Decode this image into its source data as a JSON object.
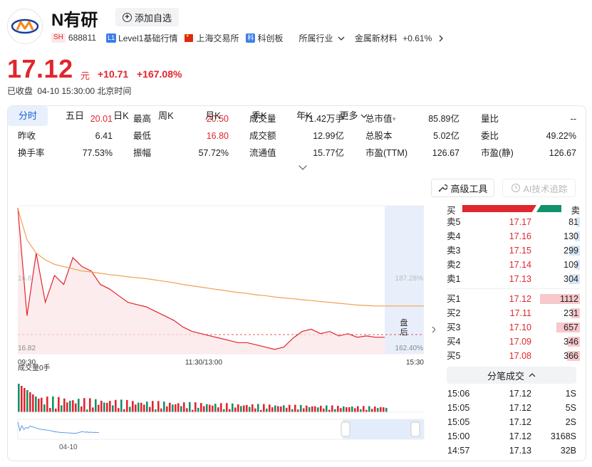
{
  "stock": {
    "name": "N有研",
    "market_tag": "SH",
    "code": "688811",
    "level_tag": "L1",
    "level_text": "Level1基础行情",
    "exchange": "上海交易所",
    "board_tag": "科",
    "board": "科创板",
    "industry_label": "所属行业",
    "sector": "金属新材料",
    "sector_change": "+0.61%",
    "watch_label": "添加自选"
  },
  "quote": {
    "price": "17.12",
    "unit": "元",
    "change": "+10.71",
    "change_pct": "+167.08%",
    "status": "已收盘",
    "datetime": "04-10 15:30:00 北京时间"
  },
  "stats": [
    [
      {
        "label": "今开",
        "value": "20.01",
        "color": "red"
      },
      {
        "label": "最高",
        "value": "20.50",
        "color": "red"
      },
      {
        "label": "成交量",
        "value": "71.42万手"
      },
      {
        "label": "总市值",
        "value": "85.89亿",
        "dropdown": true
      },
      {
        "label": "量比",
        "value": "--"
      }
    ],
    [
      {
        "label": "昨收",
        "value": "6.41"
      },
      {
        "label": "最低",
        "value": "16.80",
        "color": "red"
      },
      {
        "label": "成交额",
        "value": "12.99亿"
      },
      {
        "label": "总股本",
        "value": "5.02亿"
      },
      {
        "label": "委比",
        "value": "49.22%"
      }
    ],
    [
      {
        "label": "换手率",
        "value": "77.53%"
      },
      {
        "label": "振幅",
        "value": "57.72%"
      },
      {
        "label": "流通值",
        "value": "15.77亿"
      },
      {
        "label": "市盈(TTM)",
        "value": "126.67"
      },
      {
        "label": "市盈(静)",
        "value": "126.67"
      }
    ]
  ],
  "tabs": [
    "分时",
    "五日",
    "日K",
    "周K",
    "月K",
    "季K",
    "年K",
    "更多"
  ],
  "active_tab": 0,
  "tools": {
    "advanced": "高级工具",
    "ai": "AI技术追踪"
  },
  "chart": {
    "high_label": "16.8",
    "low_label": "16.82",
    "pct_high": "187.28%",
    "pct_low": "162.40%",
    "time_start": "09:30",
    "time_mid": "11:30/13:00",
    "time_end": "15:30",
    "after_hours": "盘后",
    "volume_label": "成交量0手",
    "nav_date": "04-10"
  },
  "chart_data": {
    "type": "line",
    "title": "",
    "xlabel": "",
    "ylabel": "",
    "x_ticks": [
      "09:30",
      "11:30/13:00",
      "15:30"
    ],
    "series": [
      {
        "values": [
          20.01,
          17.6,
          19.0,
          17.9,
          18.5,
          18.3,
          18.9,
          18.7,
          18.6,
          18.3,
          18.2,
          18.05,
          17.9,
          17.85,
          17.8,
          17.7,
          17.6,
          17.5,
          17.35,
          17.25,
          17.2,
          17.15,
          17.1,
          17.05,
          17.0,
          17.0,
          16.95,
          16.9,
          16.85,
          16.9,
          17.1,
          17.25,
          17.3,
          17.2,
          17.25,
          17.15,
          17.2,
          17.12,
          17.15,
          17.12,
          17.12
        ]
      },
      {
        "values": [
          20.0,
          19.3,
          19.0,
          18.85,
          18.75,
          18.7,
          18.65,
          18.6,
          18.58,
          18.55,
          18.52,
          18.5,
          18.47,
          18.45,
          18.43,
          18.4,
          18.37,
          18.34,
          18.3,
          18.27,
          18.24,
          18.21,
          18.18,
          18.15,
          18.12,
          18.1,
          18.07,
          18.05,
          18.02,
          18.0,
          17.98,
          17.96,
          17.94,
          17.92,
          17.9,
          17.88,
          17.86,
          17.84,
          17.83,
          17.82,
          17.82
        ]
      }
    ],
    "prev_close": 17.12
  },
  "orderbook": {
    "buy_label": "买",
    "sell_label": "卖",
    "asks": [
      {
        "label": "卖5",
        "price": "17.17",
        "vol": "81",
        "ratio": 0.07
      },
      {
        "label": "卖4",
        "price": "17.16",
        "vol": "130",
        "ratio": 0.12
      },
      {
        "label": "卖3",
        "price": "17.15",
        "vol": "299",
        "ratio": 0.27
      },
      {
        "label": "卖2",
        "price": "17.14",
        "vol": "109",
        "ratio": 0.1
      },
      {
        "label": "卖1",
        "price": "17.13",
        "vol": "304",
        "ratio": 0.27
      }
    ],
    "bids": [
      {
        "label": "买1",
        "price": "17.12",
        "vol": "1112",
        "ratio": 1.0
      },
      {
        "label": "买2",
        "price": "17.11",
        "vol": "231",
        "ratio": 0.21
      },
      {
        "label": "买3",
        "price": "17.10",
        "vol": "657",
        "ratio": 0.59
      },
      {
        "label": "买4",
        "price": "17.09",
        "vol": "346",
        "ratio": 0.31
      },
      {
        "label": "买5",
        "price": "17.08",
        "vol": "366",
        "ratio": 0.33
      }
    ]
  },
  "trades_label": "分笔成交",
  "trades": [
    {
      "time": "15:06",
      "price": "17.12",
      "vol": "1S"
    },
    {
      "time": "15:05",
      "price": "17.12",
      "vol": "5S"
    },
    {
      "time": "15:05",
      "price": "17.12",
      "vol": "2S"
    },
    {
      "time": "15:00",
      "price": "17.12",
      "vol": "3168S"
    },
    {
      "time": "14:57",
      "price": "17.13",
      "vol": "32B"
    }
  ],
  "colors": {
    "up": "#e0262e",
    "down": "#12916b",
    "accent": "#1a5fd6",
    "avg_line": "#f0a050"
  }
}
